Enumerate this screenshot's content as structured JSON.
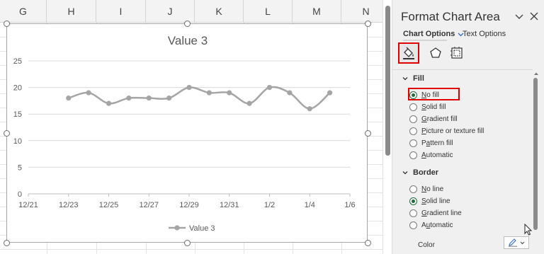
{
  "sheet": {
    "columns": [
      "G",
      "H",
      "I",
      "J",
      "K",
      "L",
      "M",
      "N"
    ]
  },
  "chart": {
    "title": "Value 3",
    "legend_label": "Value 3"
  },
  "chart_data": {
    "type": "line",
    "title": "Value 3",
    "x_tick_labels": [
      "12/21",
      "12/23",
      "12/25",
      "12/27",
      "12/29",
      "12/31",
      "1/2",
      "1/4",
      "1/6"
    ],
    "y_tick_labels": [
      "0",
      "5",
      "10",
      "15",
      "20",
      "25"
    ],
    "ylim": [
      0,
      25
    ],
    "xlim": [
      "12/21",
      "1/6"
    ],
    "grid": true,
    "legend_position": "bottom",
    "series": [
      {
        "name": "Value 3",
        "x": [
          "12/23",
          "12/24",
          "12/25",
          "12/26",
          "12/27",
          "12/28",
          "12/29",
          "12/30",
          "12/31",
          "1/1",
          "1/2",
          "1/3",
          "1/4",
          "1/5"
        ],
        "values": [
          18,
          19,
          17,
          18,
          18,
          18,
          20,
          19,
          19,
          17,
          20,
          19,
          16,
          19
        ],
        "color": "#a5a5a5"
      }
    ]
  },
  "pane": {
    "title": "Format Chart Area",
    "tab_chart_options": "Chart Options",
    "tab_text_options": "Text Options",
    "fill_section": "Fill",
    "fill_options": [
      {
        "pre": "",
        "u": "N",
        "post": "o fill",
        "selected": true
      },
      {
        "pre": "",
        "u": "S",
        "post": "olid fill",
        "selected": false
      },
      {
        "pre": "",
        "u": "G",
        "post": "radient fill",
        "selected": false
      },
      {
        "pre": "",
        "u": "P",
        "post": "icture or texture fill",
        "selected": false
      },
      {
        "pre": "P",
        "u": "a",
        "post": "ttern fill",
        "selected": false
      },
      {
        "pre": "",
        "u": "A",
        "post": "utomatic",
        "selected": false
      }
    ],
    "border_section": "Border",
    "border_options": [
      {
        "pre": "",
        "u": "N",
        "post": "o line",
        "selected": false
      },
      {
        "pre": "",
        "u": "S",
        "post": "olid line",
        "selected": true
      },
      {
        "pre": "",
        "u": "G",
        "post": "radient line",
        "selected": false
      },
      {
        "pre": "A",
        "u": "u",
        "post": "tomatic",
        "selected": false
      }
    ],
    "color_label": "Color"
  },
  "colors": {
    "accent_green": "#1e6b3c",
    "highlight_red": "#e00000",
    "series_gray": "#a5a5a5"
  }
}
